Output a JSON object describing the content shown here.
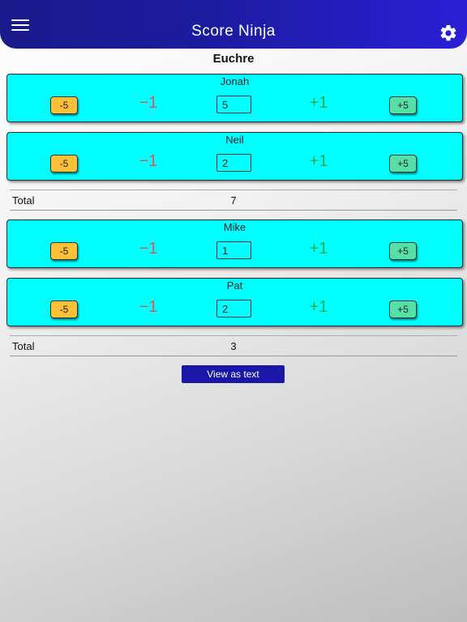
{
  "app": {
    "title": "Score Ninja"
  },
  "game": {
    "title": "Euchre"
  },
  "controls": {
    "minus5": "-5",
    "minus1": "−1",
    "plus1": "+1",
    "plus5": "+5"
  },
  "teams": [
    {
      "players": [
        {
          "name": "Jonah",
          "score": "5"
        },
        {
          "name": "Neil",
          "score": "2"
        }
      ],
      "total_label": "Total",
      "total": "7"
    },
    {
      "players": [
        {
          "name": "Mike",
          "score": "1"
        },
        {
          "name": "Pat",
          "score": "2"
        }
      ],
      "total_label": "Total",
      "total": "3"
    }
  ],
  "actions": {
    "view_as_text": "View as text"
  },
  "icons": {
    "menu": "hamburger-menu-icon",
    "settings": "gear-icon"
  },
  "colors": {
    "header": "#1c1ca0",
    "card": "#00ffff",
    "minus5_button": "#fbbf38",
    "plus5_button": "#55e0a8",
    "minus1_text": "#e05555",
    "plus1_text": "#2fa84a",
    "view_button": "#1a16a8"
  }
}
